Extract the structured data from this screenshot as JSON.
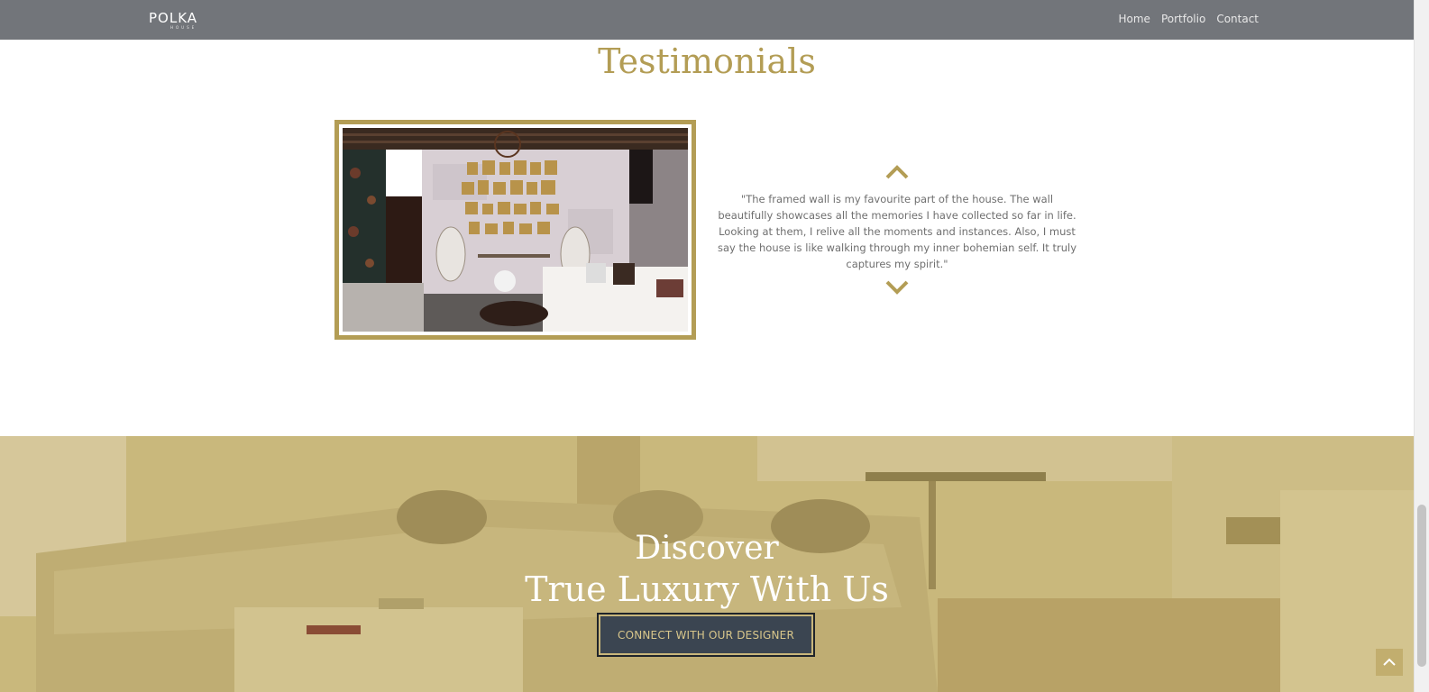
{
  "brand": {
    "name": "POLKA",
    "sub": "HOUSE"
  },
  "nav": {
    "items": [
      "Home",
      "Portfolio",
      "Contact"
    ]
  },
  "testimonials": {
    "title": "Testimonials",
    "quote": "\"The framed wall is my favourite part of the house. The wall beautifully showcases all the memories I have collected so far in life. Looking at them, I relive all the moments and instances. Also, I must say the house is like walking through my inner bohemian self. It truly captures my spirit.\"",
    "prev_icon": "chevron-up-icon",
    "next_icon": "chevron-down-icon"
  },
  "hero": {
    "line1": "Discover",
    "line2": "True Luxury With Us",
    "cta_label": "CONNECT WITH OUR DESIGNER"
  },
  "colors": {
    "accent_gold": "#b39d55",
    "navbar_gray": "#72757a",
    "button_dark": "#3b4551"
  }
}
